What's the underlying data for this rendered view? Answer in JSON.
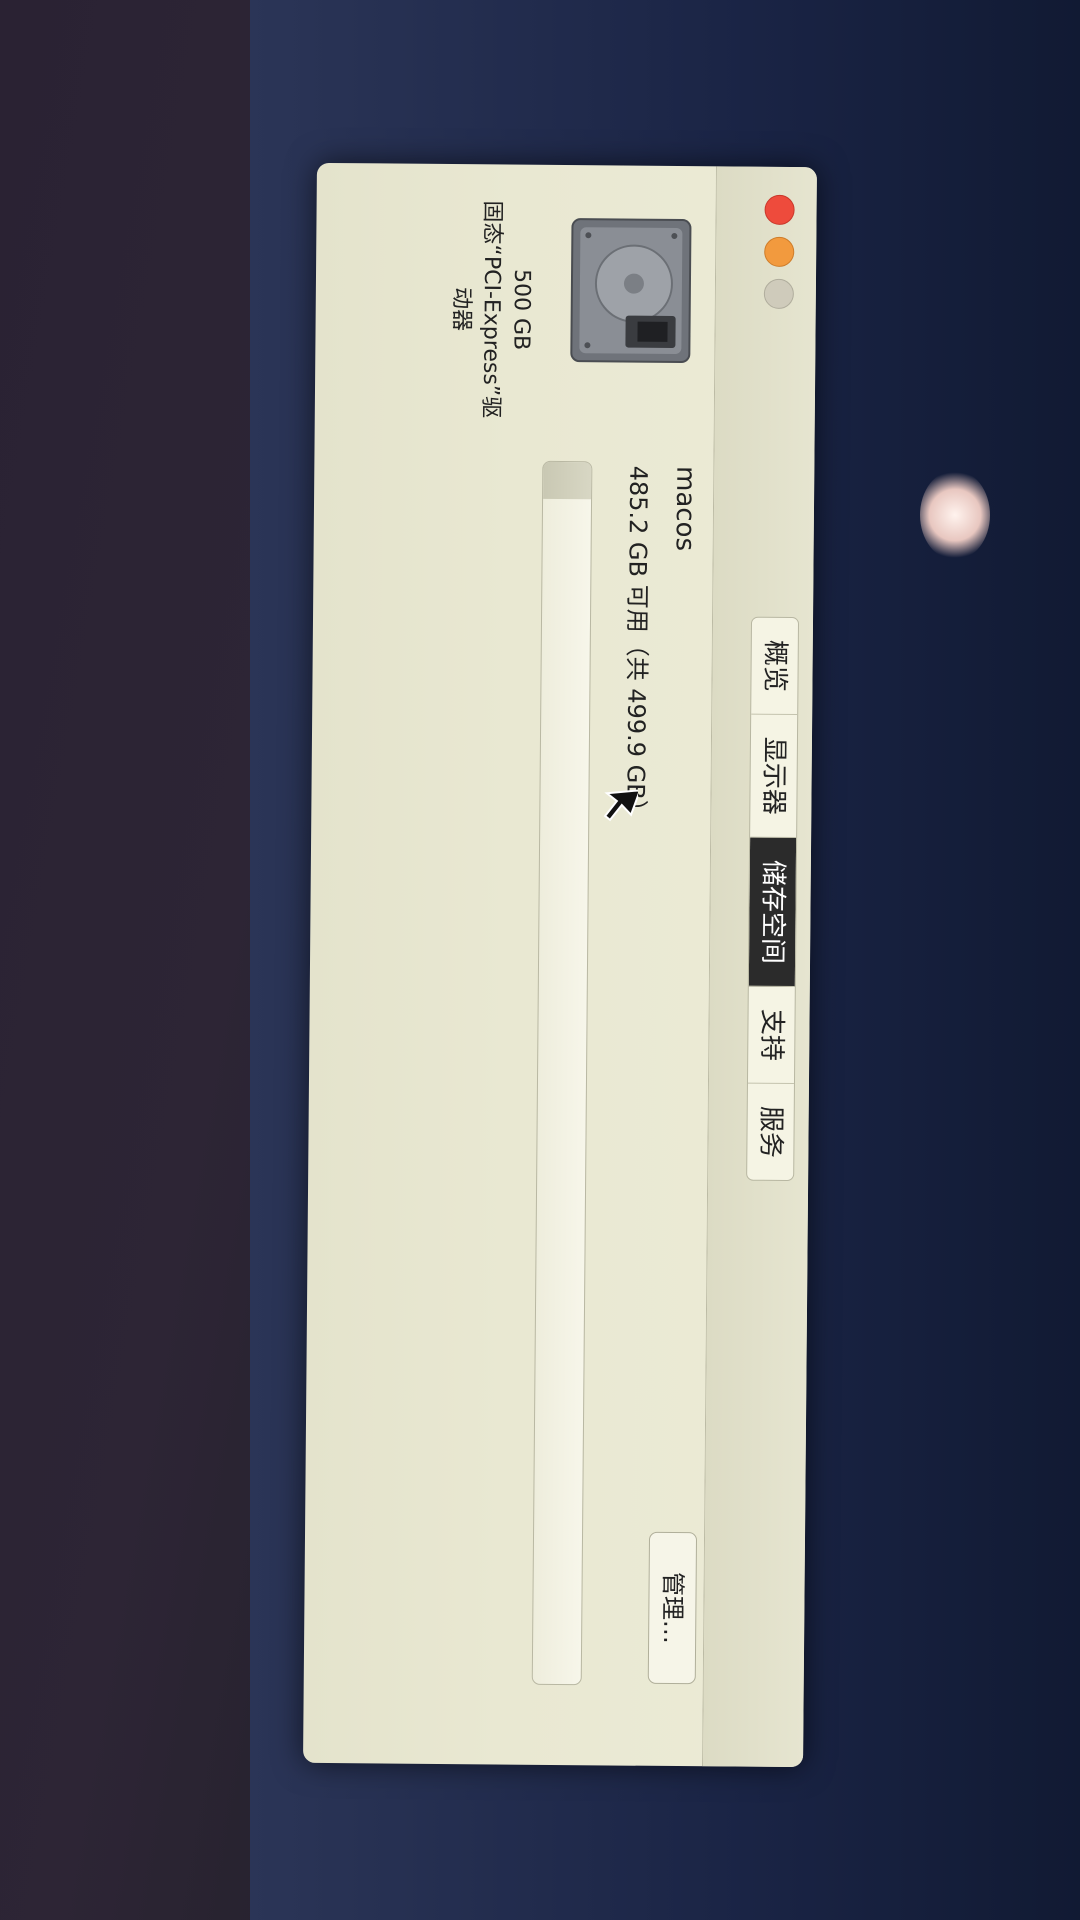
{
  "window": {
    "tabs": [
      {
        "label": "概览",
        "active": false
      },
      {
        "label": "显示器",
        "active": false
      },
      {
        "label": "储存空间",
        "active": true
      },
      {
        "label": "支持",
        "active": false
      },
      {
        "label": "服务",
        "active": false
      }
    ]
  },
  "storage": {
    "drive_icon": "hard-drive-icon",
    "capacity": "500 GB",
    "drive_type": "固态“PCI-Express”驱动器",
    "volume_name": "macos",
    "available_text": "485.2 GB 可用（共 499.9 GB）",
    "used_fraction": 0.03,
    "manage_label": "管理…"
  },
  "colors": {
    "close": "#ee4b3c",
    "minimize": "#f29a3e",
    "active_tab": "#2b2b2b"
  }
}
